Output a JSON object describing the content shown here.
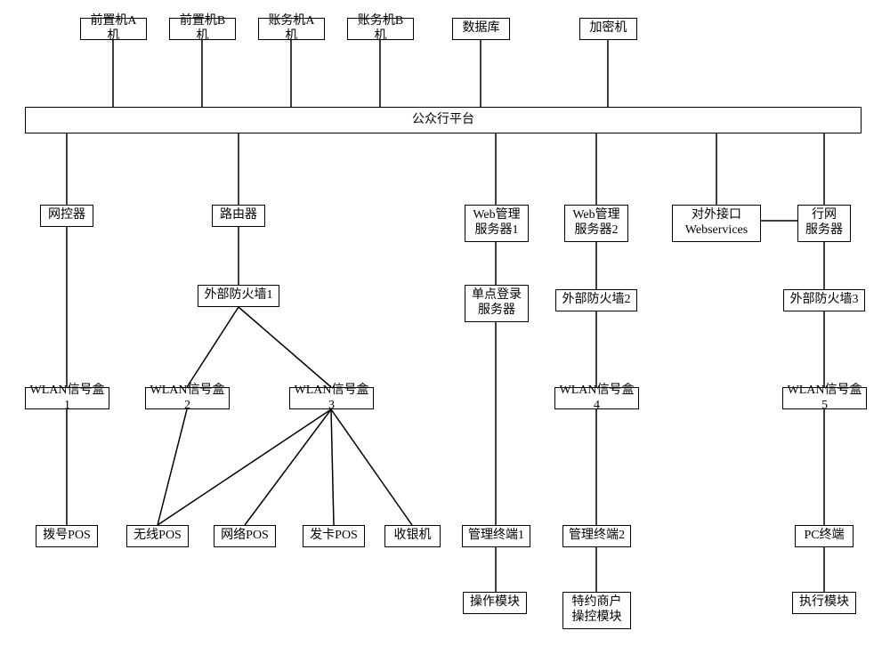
{
  "diagram": {
    "top": {
      "front_a": "前置机A机",
      "front_b": "前置机B机",
      "acct_a": "账务机A机",
      "acct_b": "账务机B机",
      "db": "数据库",
      "enc": "加密机"
    },
    "platform": "公众行平台",
    "row1": {
      "netctrl": "网控器",
      "router": "路由器",
      "webmgr1": "Web管理\n服务器1",
      "webmgr2": "Web管理\n服务器2",
      "extif": "对外接口\nWebservices",
      "netserver": "行网\n服务器"
    },
    "fw": {
      "fw1": "外部防火墙1",
      "fw2": "外部防火墙2",
      "fw3": "外部防火墙3",
      "sso": "单点登录\n服务器"
    },
    "wlan": {
      "w1": "WLAN信号盒1",
      "w2": "WLAN信号盒2",
      "w3": "WLAN信号盒3",
      "w4": "WLAN信号盒4",
      "w5": "WLAN信号盒5"
    },
    "pos": {
      "dial": "拨号POS",
      "wireless": "无线POS",
      "net": "网络POS",
      "card": "发卡POS",
      "cashier": "收银机",
      "mgmt1": "管理终端1",
      "mgmt2": "管理终端2",
      "pcterm": "PC终端"
    },
    "bottom": {
      "opmod": "操作模块",
      "merchant": "特约商户\n操控模块",
      "exec": "执行模块"
    }
  }
}
